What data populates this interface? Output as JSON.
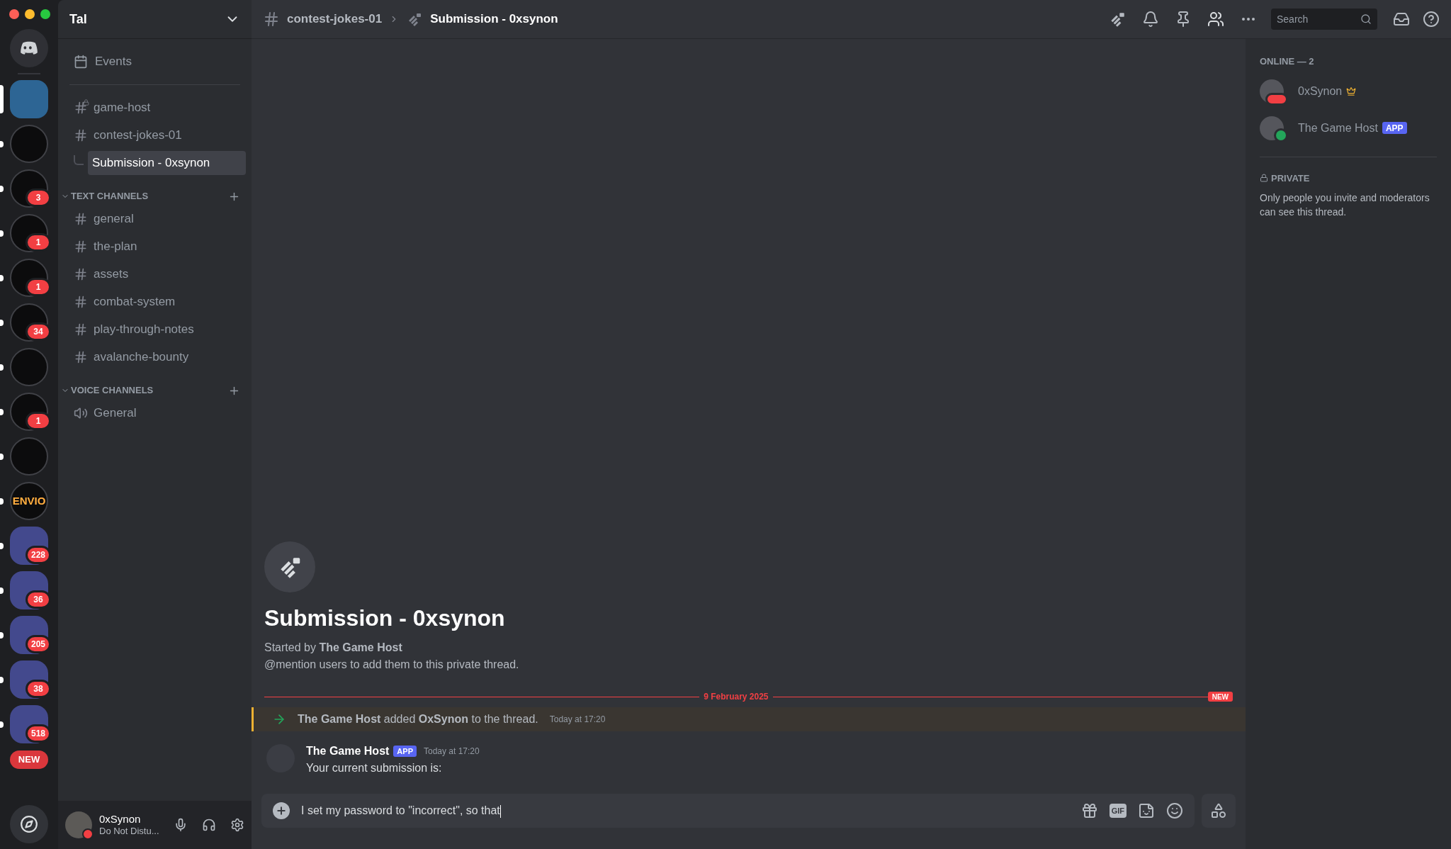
{
  "servers": [
    {
      "kind": "home",
      "selected": false,
      "unread": false
    },
    {
      "kind": "server",
      "selected": true,
      "unread": false
    },
    {
      "kind": "server",
      "selected": false,
      "unread": true
    },
    {
      "kind": "server",
      "selected": false,
      "unread": true,
      "badge": "3"
    },
    {
      "kind": "server",
      "selected": false,
      "unread": true,
      "badge": "1"
    },
    {
      "kind": "server",
      "selected": false,
      "unread": true,
      "badge": "1"
    },
    {
      "kind": "server",
      "selected": false,
      "unread": true,
      "badge": "34"
    },
    {
      "kind": "server",
      "selected": false,
      "unread": true
    },
    {
      "kind": "server",
      "selected": false,
      "unread": true,
      "badge": "1"
    },
    {
      "kind": "server",
      "selected": false,
      "unread": true
    },
    {
      "kind": "server",
      "selected": false,
      "unread": true,
      "label": "ENVIO"
    },
    {
      "kind": "folder",
      "selected": false,
      "unread": true,
      "badge": "228"
    },
    {
      "kind": "folder",
      "selected": false,
      "unread": true,
      "badge": "36"
    },
    {
      "kind": "folder",
      "selected": false,
      "unread": true,
      "badge": "205"
    },
    {
      "kind": "folder",
      "selected": false,
      "unread": true,
      "badge": "38"
    },
    {
      "kind": "folder",
      "selected": false,
      "unread": true,
      "badge": "518"
    }
  ],
  "new_pill": "NEW",
  "server_name": "Tal",
  "events": "Events",
  "channels": [
    {
      "kind": "locked",
      "name": "game-host",
      "selected": false
    },
    {
      "kind": "text",
      "name": "contest-jokes-01",
      "selected": false
    },
    {
      "kind": "thread",
      "name": "Submission - 0xsynon",
      "selected": true
    }
  ],
  "categories": [
    {
      "name": "TEXT CHANNELS",
      "expanded": true,
      "channels": [
        {
          "kind": "text",
          "name": "general",
          "selected": false
        },
        {
          "kind": "text",
          "name": "the-plan",
          "selected": false
        },
        {
          "kind": "text",
          "name": "assets",
          "selected": false
        },
        {
          "kind": "text",
          "name": "combat-system",
          "selected": false
        },
        {
          "kind": "text",
          "name": "play-through-notes",
          "selected": false
        },
        {
          "kind": "text",
          "name": "avalanche-bounty",
          "selected": false
        }
      ]
    },
    {
      "name": "VOICE CHANNELS",
      "expanded": true,
      "channels": [
        {
          "kind": "voice",
          "name": "General",
          "selected": false
        }
      ]
    }
  ],
  "user_panel": {
    "name": "0xSynon",
    "status": "Do Not Distu..."
  },
  "header": {
    "parent": "contest-jokes-01",
    "thread": "Submission - 0xsynon",
    "search_placeholder": "Search"
  },
  "thread_intro": {
    "title": "Submission - 0xsynon",
    "started_by": "Started by **The Game Host**",
    "hint": "@mention users to add them to this private thread."
  },
  "divider": {
    "date": "9 February 2025",
    "new_label": "NEW"
  },
  "messages": [
    {
      "kind": "system",
      "text": "**The Game Host** added **OxSynon** to the thread.",
      "time": "Today at 17:20",
      "highlighted": true
    },
    {
      "kind": "message",
      "author": "The Game Host",
      "badge": "APP",
      "time": "Today at 17:20",
      "text": "Your current submission is:",
      "highlighted": false
    }
  ],
  "composer": {
    "value": "I set my password to \"incorrect\", so that",
    "gif_label": "GIF"
  },
  "members": {
    "heading": "ONLINE — 2",
    "items": [
      {
        "name": "0xSynon",
        "kind": "dnd",
        "owner": true
      },
      {
        "name": "The Game Host",
        "kind": "online",
        "owner": false,
        "badge": "APP"
      }
    ]
  },
  "privacy": {
    "heading": "PRIVATE",
    "text": "Only people you invite and moderators can see this thread."
  }
}
